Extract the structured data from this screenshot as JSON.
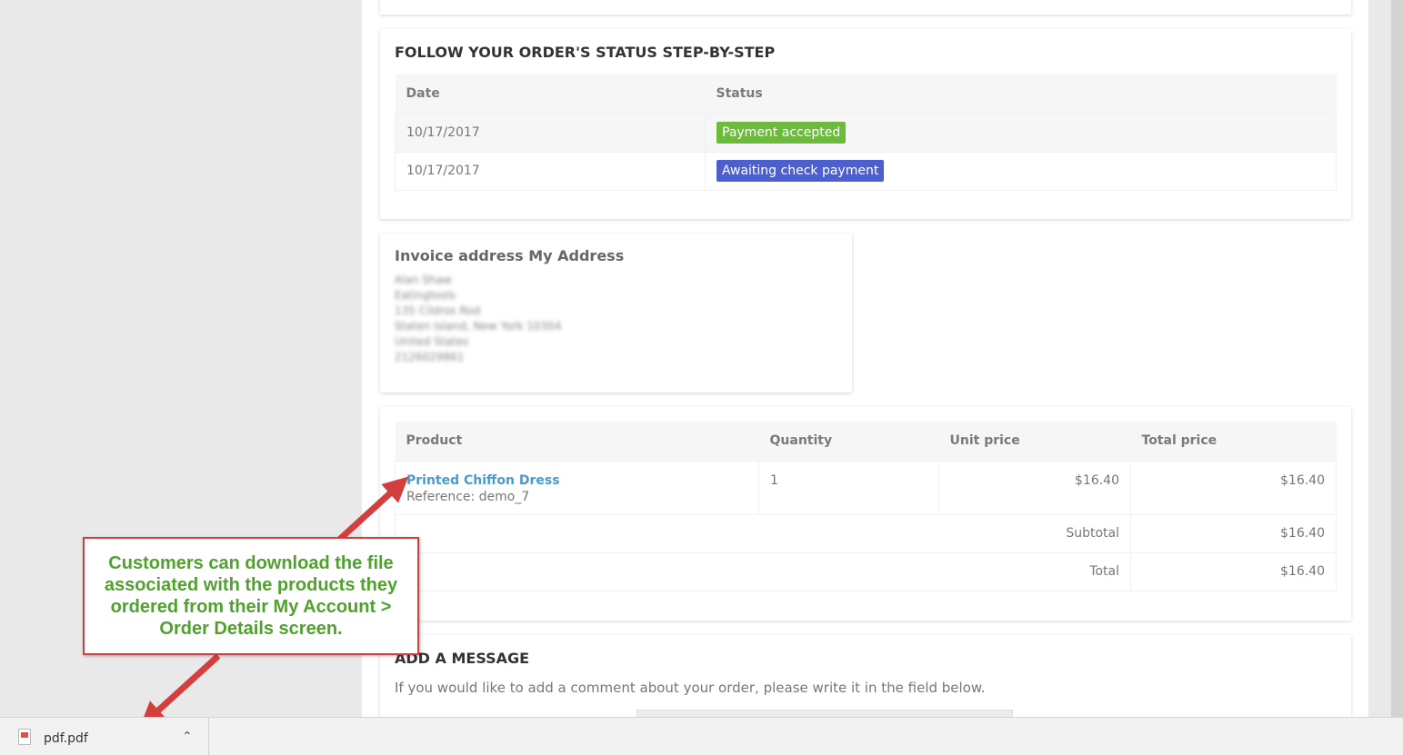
{
  "status_section": {
    "title": "FOLLOW YOUR ORDER'S STATUS STEP-BY-STEP",
    "headers": [
      "Date",
      "Status"
    ],
    "rows": [
      {
        "date": "10/17/2017",
        "status": "Payment accepted",
        "color": "#6cbb3c"
      },
      {
        "date": "10/17/2017",
        "status": "Awaiting check payment",
        "color": "#4b5fcf"
      }
    ]
  },
  "invoice": {
    "title": "Invoice address My Address",
    "lines": [
      "Alan Shaw",
      "Eatingtools",
      "135 Cildros Rod",
      "Staten Island, New York 10304",
      "United States",
      "2126029861"
    ]
  },
  "products": {
    "headers": [
      "Product",
      "Quantity",
      "Unit price",
      "Total price"
    ],
    "item": {
      "name": "Printed Chiffon Dress",
      "reference": "Reference: demo_7",
      "quantity": "1",
      "unit_price": "$16.40",
      "total_price": "$16.40"
    },
    "subtotal_label": "Subtotal",
    "subtotal_value": "$16.40",
    "total_label": "Total",
    "total_value": "$16.40"
  },
  "message": {
    "title": "ADD A MESSAGE",
    "text": "If you would like to add a comment about your order, please write it in the field below."
  },
  "callout": {
    "text": "Customers can download the file associated with the products they ordered from their My Account > Order Details screen.",
    "color": "#4fa22e",
    "border_color": "#d33f3f"
  },
  "downloads": {
    "file_name": "pdf.pdf",
    "file_icon": "pdf-file-icon",
    "chevron_icon": "chevron-up-icon"
  }
}
